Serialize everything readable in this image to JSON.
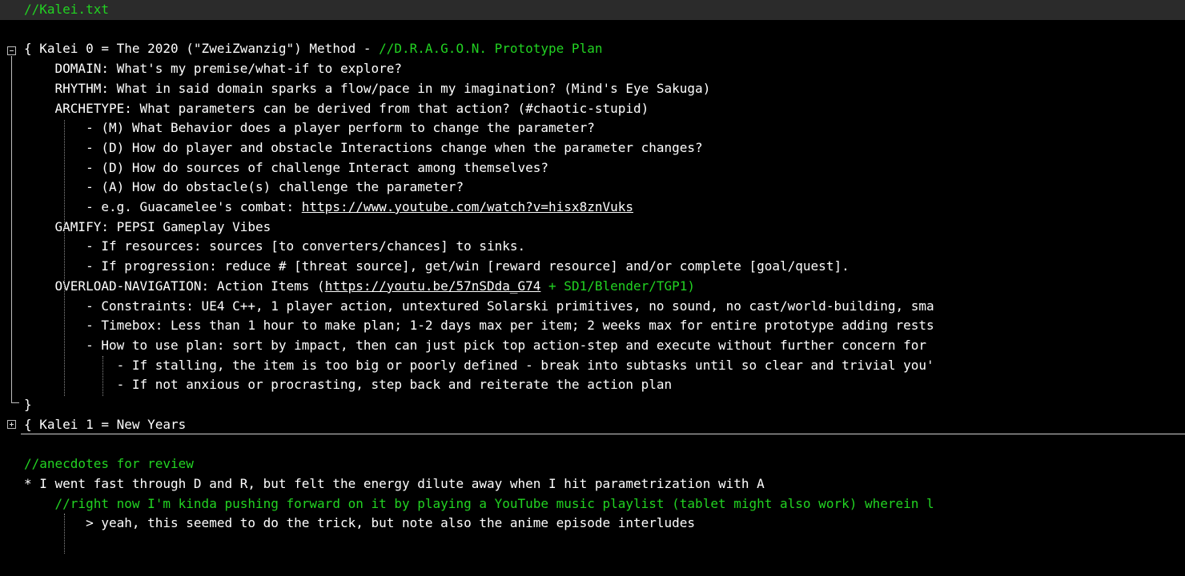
{
  "editor": {
    "lines": [
      {
        "indent": "",
        "segs": [
          {
            "t": "//Kalei.txt",
            "s": "c"
          }
        ],
        "highlight": true
      },
      {
        "indent": "",
        "segs": []
      },
      {
        "indent": "",
        "segs": [
          {
            "t": "{ Kalei 0 = The 2020 (\"ZweiZwanzig\") Method - "
          },
          {
            "t": "//D.R.A.G.O.N. Prototype Plan",
            "s": "c"
          }
        ]
      },
      {
        "indent": "    ",
        "segs": [
          {
            "t": "DOMAIN: What's my premise/what-if to explore?"
          }
        ]
      },
      {
        "indent": "    ",
        "segs": [
          {
            "t": "RHYTHM: What in said domain sparks a flow/pace in my imagination? (Mind's Eye Sakuga)"
          }
        ]
      },
      {
        "indent": "    ",
        "segs": [
          {
            "t": "ARCHETYPE: What parameters can be derived from that action? (#chaotic-stupid)"
          }
        ]
      },
      {
        "indent": "        ",
        "segs": [
          {
            "t": "- (M) What Behavior does a player perform to change the parameter?"
          }
        ]
      },
      {
        "indent": "        ",
        "segs": [
          {
            "t": "- (D) How do player and obstacle Interactions change when the parameter changes?"
          }
        ]
      },
      {
        "indent": "        ",
        "segs": [
          {
            "t": "- (D) How do sources of challenge Interact among themselves?"
          }
        ]
      },
      {
        "indent": "        ",
        "segs": [
          {
            "t": "- (A) How do obstacle(s) challenge the parameter?"
          }
        ]
      },
      {
        "indent": "        ",
        "segs": [
          {
            "t": "- e.g. Guacamelee's combat: "
          },
          {
            "t": "https://www.youtube.com/watch?v=hisx8znVuks",
            "s": "u"
          }
        ]
      },
      {
        "indent": "    ",
        "segs": [
          {
            "t": "GAMIFY: PEPSI Gameplay Vibes"
          }
        ]
      },
      {
        "indent": "        ",
        "segs": [
          {
            "t": "- If resources: sources [to converters/chances] to sinks."
          }
        ]
      },
      {
        "indent": "        ",
        "segs": [
          {
            "t": "- If progression: reduce # [threat source], get/win [reward resource] and/or complete [goal/quest]."
          }
        ]
      },
      {
        "indent": "    ",
        "segs": [
          {
            "t": "OVERLOAD-NAVIGATION: Action Items ("
          },
          {
            "t": "https://youtu.be/57nSDda_G74",
            "s": "u"
          },
          {
            "t": " + SD1/Blender/TGP1)",
            "s": "c"
          }
        ]
      },
      {
        "indent": "        ",
        "segs": [
          {
            "t": "- Constraints: UE4 C++, 1 player action, untextured Solarski primitives, no sound, no cast/world-building, sma"
          }
        ]
      },
      {
        "indent": "        ",
        "segs": [
          {
            "t": "- Timebox: Less than 1 hour to make plan; 1-2 days max per item; 2 weeks max for entire prototype adding rests"
          }
        ]
      },
      {
        "indent": "        ",
        "segs": [
          {
            "t": "- How to use plan: sort by impact, then can just pick top action-step and execute without further concern for"
          }
        ]
      },
      {
        "indent": "            ",
        "segs": [
          {
            "t": "- If stalling, the item is too big or poorly defined - break into subtasks until so clear and trivial you'"
          }
        ]
      },
      {
        "indent": "            ",
        "segs": [
          {
            "t": "- If not anxious or procrasting, step back and reiterate the action plan"
          }
        ]
      },
      {
        "indent": "",
        "segs": [
          {
            "t": "}"
          }
        ]
      },
      {
        "indent": "",
        "segs": [
          {
            "t": "{ Kalei 1 = New Years"
          }
        ]
      },
      {
        "indent": "",
        "segs": []
      },
      {
        "indent": "",
        "segs": [
          {
            "t": "//anecdotes for review",
            "s": "c"
          }
        ]
      },
      {
        "indent": "",
        "segs": [
          {
            "t": "* I went fast through D and R, but felt the energy dilute away when I hit parametrization with A"
          }
        ]
      },
      {
        "indent": "    ",
        "segs": [
          {
            "t": "//right now I'm kinda pushing forward on it by playing a YouTube music playlist (tablet might also work) wherein l",
            "s": "c"
          }
        ]
      },
      {
        "indent": "        ",
        "segs": [
          {
            "t": "> yeah, this seemed to do the trick, but note also the anime episode interludes"
          }
        ]
      },
      {
        "indent": "        ",
        "segs": []
      }
    ]
  },
  "fold_markers": [
    {
      "line": 2,
      "kind": "collapse-icon"
    },
    {
      "line": 21,
      "kind": "expand-icon"
    }
  ],
  "colors": {
    "background": "#000000",
    "text": "#ffffff",
    "comment": "#22d322",
    "current_line": "#2b2b2b"
  }
}
